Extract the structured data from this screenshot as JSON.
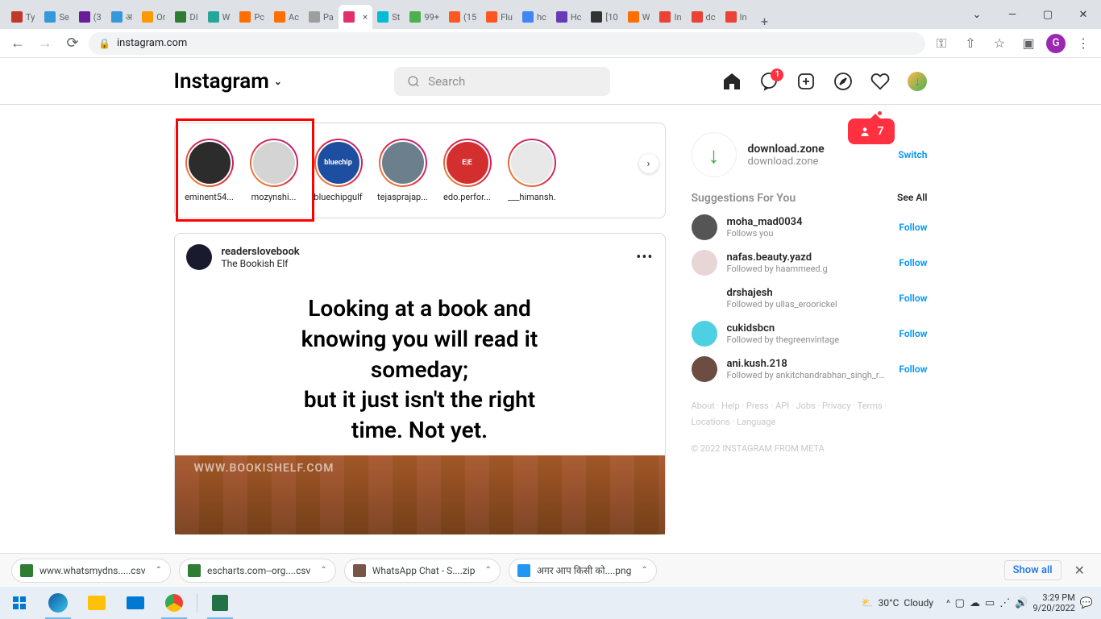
{
  "chrome": {
    "tabs": [
      {
        "title": "Ty",
        "favColor": "#c0392b"
      },
      {
        "title": "Se",
        "favColor": "#3498db"
      },
      {
        "title": "(3",
        "favColor": "#6a1b9a"
      },
      {
        "title": "अ",
        "favColor": "#3498db"
      },
      {
        "title": "Or",
        "favColor": "#ff9900"
      },
      {
        "title": "DI",
        "favColor": "#2e7d32"
      },
      {
        "title": "W",
        "favColor": "#26a69a"
      },
      {
        "title": "Pc",
        "favColor": "#ff6f00"
      },
      {
        "title": "Ac",
        "favColor": "#ff6f00"
      },
      {
        "title": "Pa",
        "favColor": "#9e9e9e"
      },
      {
        "title": "",
        "favColor": "#e1306c",
        "active": true,
        "closable": true
      },
      {
        "title": "St",
        "favColor": "#00bcd4"
      },
      {
        "title": "99+",
        "favColor": "#4caf50"
      },
      {
        "title": "(15",
        "favColor": "#ff5722"
      },
      {
        "title": "Flu",
        "favColor": "#ff5722"
      },
      {
        "title": "hc",
        "favColor": "#4285f4"
      },
      {
        "title": "Hc",
        "favColor": "#673ab7"
      },
      {
        "title": "[10",
        "favColor": "#333333"
      },
      {
        "title": "W",
        "favColor": "#ff6f00"
      },
      {
        "title": "In",
        "favColor": "#ea4335"
      },
      {
        "title": "dc",
        "favColor": "#ea4335"
      },
      {
        "title": "In",
        "favColor": "#ea4335"
      }
    ],
    "url": "instagram.com",
    "profile_letter": "G"
  },
  "ig": {
    "logo": "Instagram",
    "search_placeholder": "Search",
    "msg_badge": "1",
    "notif_count": "7",
    "stories": [
      {
        "label": "eminent54...",
        "bg": "#2c2c2c"
      },
      {
        "label": "mozynshi...",
        "bg": "#d4d4d4"
      },
      {
        "label": "bluechipgulf",
        "bg": "#1e4ea0",
        "text": "bluechip"
      },
      {
        "label": "tejasprajap...",
        "bg": "#6b7f8c"
      },
      {
        "label": "edo.perfor...",
        "bg": "#d32f2f",
        "text": "E|E"
      },
      {
        "label": "___himansh.",
        "bg": "#e8e8e8"
      }
    ],
    "post": {
      "username": "readerslovebook",
      "subtitle": "The Bookish Elf",
      "text_l1": "Looking at a book and",
      "text_l2": "knowing you will read it",
      "text_l3": "someday;",
      "text_l4": "but it just isn't the right",
      "text_l5": "time. Not yet.",
      "watermark": "WWW.BOOKISHELF.COM"
    },
    "sidebar": {
      "username": "download.zone",
      "displayname": "download.zone",
      "switch": "Switch",
      "sugg_title": "Suggestions For You",
      "see_all": "See All",
      "suggestions": [
        {
          "un": "moha_mad0034",
          "rel": "Follows you",
          "bg": "#555",
          "follow": "Follow"
        },
        {
          "un": "nafas.beauty.yazd",
          "rel": "Followed by haammeed.g",
          "bg": "#e8d5d5",
          "follow": "Follow"
        },
        {
          "un": "drshajesh",
          "rel": "Followed by ullas_eroorickel",
          "bg": "#fff",
          "follow": "Follow"
        },
        {
          "un": "cukidsbcn",
          "rel": "Followed by thegreenvintage",
          "bg": "#4dd0e1",
          "follow": "Follow"
        },
        {
          "un": "ani.kush.218",
          "rel": "Followed by ankitchandrabhan_singh_raj...",
          "bg": "#6d4c41",
          "follow": "Follow"
        }
      ],
      "links": "About · Help · Press · API · Jobs · Privacy · Terms · Locations · Language",
      "copyright": "© 2022 INSTAGRAM FROM META"
    }
  },
  "downloads": {
    "items": [
      {
        "name": "www.whatsmydns.....csv",
        "icon": "#2e7d32"
      },
      {
        "name": "escharts.com--org....csv",
        "icon": "#2e7d32"
      },
      {
        "name": "WhatsApp Chat - S....zip",
        "icon": "#795548"
      },
      {
        "name": "अगर आप किसी को....png",
        "icon": "#2196f3"
      }
    ],
    "show_all": "Show all"
  },
  "taskbar": {
    "weather_temp": "30°C",
    "weather_cond": "Cloudy",
    "time": "3:29 PM",
    "date": "9/20/2022"
  }
}
